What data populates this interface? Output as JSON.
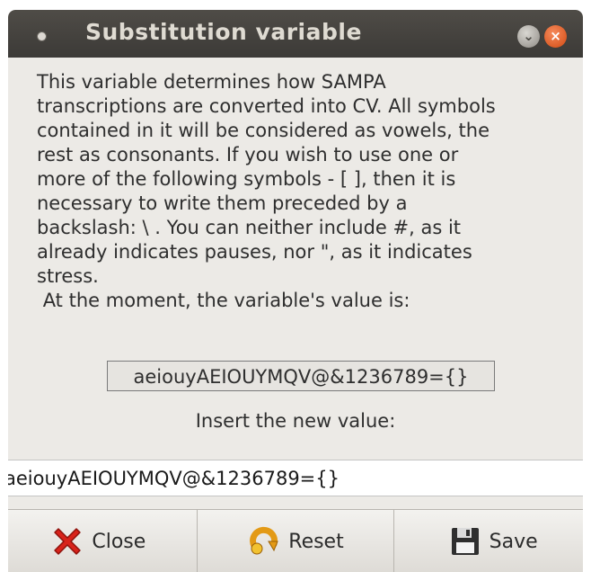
{
  "window": {
    "title": "Substitution variable",
    "minimize_glyph": "⌄",
    "close_glyph": "×"
  },
  "dialog": {
    "description": "This variable determines how SAMPA\ntranscriptions are converted into CV. All symbols\ncontained in it will be considered as vowels, the\nrest as consonants. If you wish to use one or\nmore of the following symbols - [ ], then it is\nnecessary to write them preceded by a\nbackslash: \\ . You can neither include #, as it\nalready indicates pauses, nor \", as it indicates\nstress.\n At the moment, the variable's value is:",
    "current_value": "aeiouyAEIOUYMQV@&1236789={}",
    "prompt": "Insert the new value:",
    "new_value": "aeiouyAEIOUYMQV@&1236789={}"
  },
  "buttons": {
    "close_label": "Close",
    "reset_label": "Reset",
    "save_label": "Save"
  },
  "icons": {
    "close": "red-x-icon",
    "reset": "reset-arrow-icon",
    "save": "floppy-disk-icon"
  }
}
